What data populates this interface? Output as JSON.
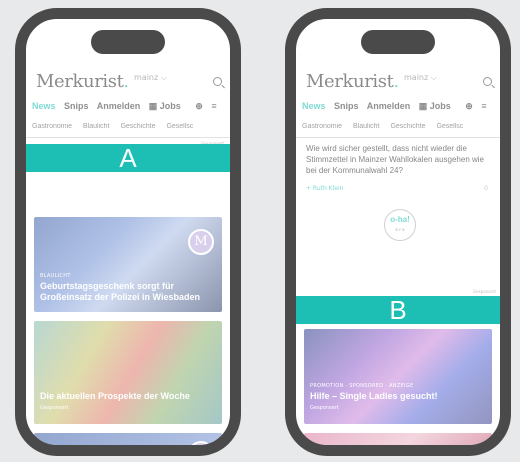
{
  "phones": {
    "a": {
      "label": "A",
      "logo": "Merkurist",
      "city": "mainz ⌵",
      "nav": [
        "News",
        "Snips",
        "Anmelden",
        "Jobs"
      ],
      "categories": [
        "Gastronomie",
        "Blaulicht",
        "Geschichte",
        "Gesellsc"
      ],
      "anzeige": "Gesponsert",
      "card1": {
        "kicker": "BLAULICHT",
        "title": "Geburtstagsgeschenk sorgt für Großeinsatz der Polizei in Wiesbaden",
        "badge": "M"
      },
      "card2": {
        "title": "Die aktuellen Prospekte der Woche",
        "promo": "Gesponsert"
      },
      "card3": {
        "badge": "M"
      }
    },
    "b": {
      "label": "B",
      "logo": "Merkurist",
      "city": "mainz ⌵",
      "nav": [
        "News",
        "Snips",
        "Anmelden",
        "Jobs"
      ],
      "categories": [
        "Gastronomie",
        "Blaulicht",
        "Geschichte",
        "Gesellsc"
      ],
      "question": "Wie wird sicher gestellt, dass nicht wieder die Stimmzettel in Mainzer Wahllokalen ausgehen wie bei der Kommunalwahl 24?",
      "question_meta": "+ Ruth Klein",
      "question_count": "0",
      "oha": "o-ha!",
      "oha_sub": "5.7 X",
      "anzeige": "Gesponsert",
      "card1": {
        "kicker": "PROMOTION · SPONSORED · ANZEIGE",
        "title": "Hilfe – Single Ladies gesucht!",
        "promo": "Gesponsert"
      }
    }
  }
}
